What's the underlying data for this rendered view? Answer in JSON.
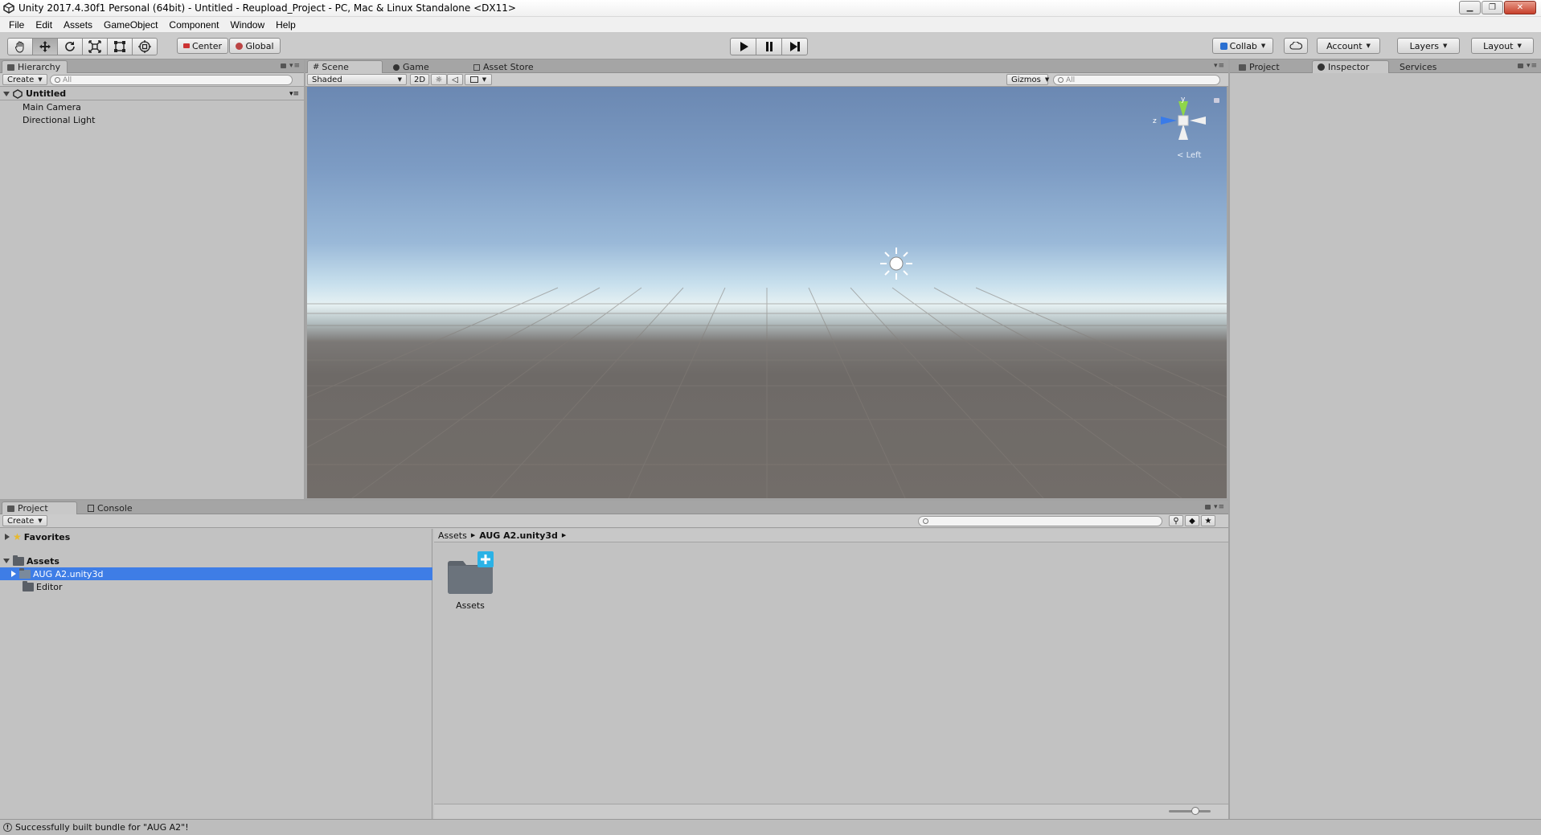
{
  "window": {
    "title": "Unity 2017.4.30f1 Personal (64bit) - Untitled - Reupload_Project - PC, Mac & Linux Standalone <DX11>"
  },
  "menu": [
    "File",
    "Edit",
    "Assets",
    "GameObject",
    "Component",
    "Window",
    "Help"
  ],
  "toolbar": {
    "tools": [
      "hand-tool",
      "move-tool",
      "rotate-tool",
      "scale-tool",
      "rect-tool",
      "transform-tool"
    ],
    "active_tool": "move-tool",
    "pivot_label": "Center",
    "space_label": "Global",
    "collab_label": "Collab",
    "account_label": "Account",
    "layers_label": "Layers",
    "layout_label": "Layout"
  },
  "hierarchy": {
    "tab": "Hierarchy",
    "create_label": "Create",
    "search_placeholder": "All",
    "scene_name": "Untitled",
    "items": [
      "Main Camera",
      "Directional Light"
    ]
  },
  "scene": {
    "tabs": [
      "Scene",
      "Game",
      "Asset Store"
    ],
    "active_tab": "Scene",
    "shading_mode": "Shaded",
    "mode_2d": "2D",
    "gizmos_label": "Gizmos",
    "search_placeholder": "All",
    "gizmo_axes": {
      "y": "y",
      "z": "z"
    },
    "view_label": "Left"
  },
  "inspector": {
    "tabs": [
      "Project",
      "Inspector",
      "Services"
    ],
    "active_tab": "Inspector"
  },
  "project": {
    "tabs": [
      "Project",
      "Console"
    ],
    "active_tab": "Project",
    "create_label": "Create",
    "favorites_label": "Favorites",
    "assets_label": "Assets",
    "tree_items": [
      "AUG A2.unity3d",
      "Editor"
    ],
    "selected_item": "AUG A2.unity3d",
    "breadcrumb": [
      "Assets",
      "AUG A2.unity3d"
    ],
    "grid_items": [
      {
        "label": "Assets"
      }
    ]
  },
  "status": {
    "message": "Successfully built bundle for \"AUG A2\"!"
  },
  "colors": {
    "selection": "#3e7de6",
    "panel_bg": "#c2c2c2",
    "sky_top": "#6b88b2",
    "ground": "#726d69"
  }
}
